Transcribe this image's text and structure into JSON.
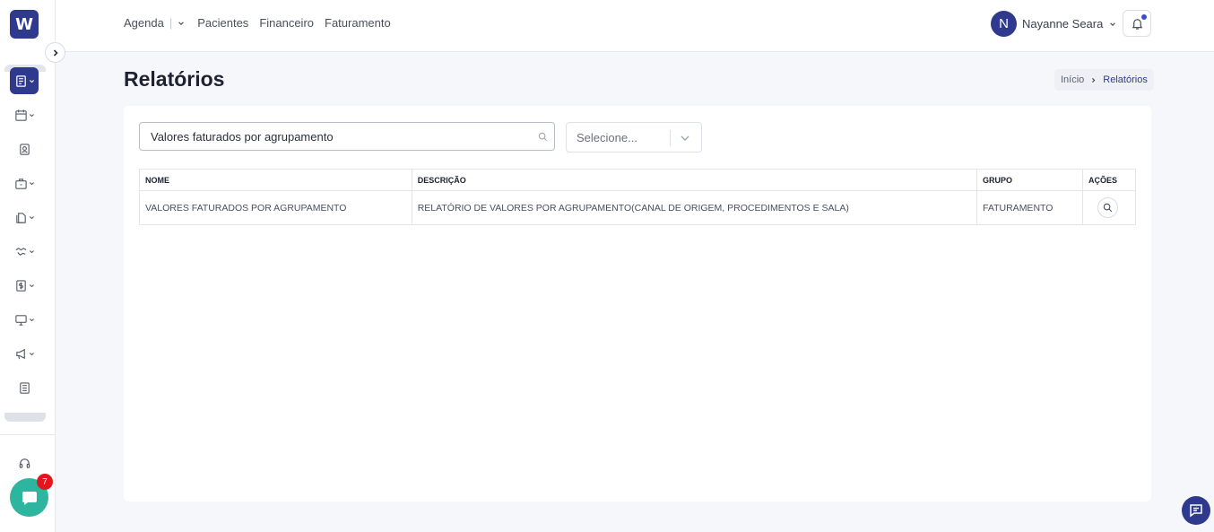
{
  "sidebar": {
    "logo_text": "W",
    "items": [
      {
        "icon": "report-icon",
        "active": true
      },
      {
        "icon": "calendar-icon"
      },
      {
        "icon": "patient-card-icon"
      },
      {
        "icon": "briefcase-icon"
      },
      {
        "icon": "documents-icon"
      },
      {
        "icon": "handshake-icon"
      },
      {
        "icon": "dollar-icon"
      },
      {
        "icon": "monitor-icon"
      },
      {
        "icon": "megaphone-icon"
      },
      {
        "icon": "notebook-icon"
      }
    ],
    "chat_badge": "7"
  },
  "header": {
    "nav": {
      "agenda": "Agenda",
      "pacientes": "Pacientes",
      "financeiro": "Financeiro",
      "faturamento": "Faturamento"
    },
    "user_initial": "N",
    "user_name": "Nayanne Seara"
  },
  "page": {
    "title": "Relatórios",
    "breadcrumb": {
      "home": "Início",
      "current": "Relatórios"
    }
  },
  "filters": {
    "search_value": "Valores faturados por agrupamento",
    "select_placeholder": "Selecione..."
  },
  "table": {
    "headers": {
      "nome": "NOME",
      "descricao": "DESCRIÇÃO",
      "grupo": "GRUPO",
      "acoes": "AÇÕES"
    },
    "rows": [
      {
        "nome": "VALORES FATURADOS POR AGRUPAMENTO",
        "descricao": "RELATÓRIO DE VALORES POR AGRUPAMENTO(CANAL DE ORIGEM, PROCEDIMENTOS E SALA)",
        "grupo": "FATURAMENTO"
      }
    ]
  },
  "colors": {
    "brand": "#2f3a8f",
    "chat": "#2eb5a0",
    "badge": "#e2161d"
  }
}
